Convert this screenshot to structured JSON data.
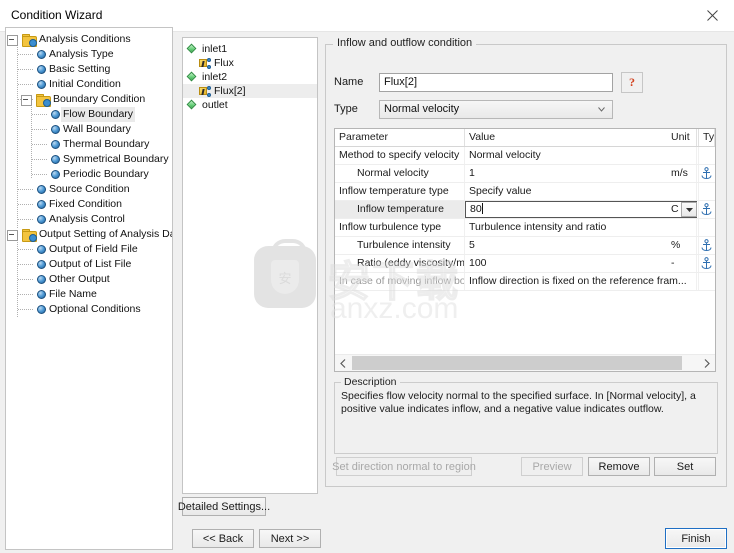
{
  "window": {
    "title": "Condition Wizard",
    "close_icon": "close-icon"
  },
  "tree": {
    "nodes": [
      {
        "label": "Analysis Conditions",
        "depth": 0,
        "icon": "folder",
        "expander": "minus"
      },
      {
        "label": "Analysis Type",
        "depth": 1,
        "icon": "sphere"
      },
      {
        "label": "Basic Setting",
        "depth": 1,
        "icon": "sphere"
      },
      {
        "label": "Initial Condition",
        "depth": 1,
        "icon": "sphere"
      },
      {
        "label": "Boundary Condition",
        "depth": 1,
        "icon": "folder",
        "expander": "minus"
      },
      {
        "label": "Flow Boundary",
        "depth": 2,
        "icon": "sphere",
        "highlight": true
      },
      {
        "label": "Wall Boundary",
        "depth": 2,
        "icon": "sphere"
      },
      {
        "label": "Thermal Boundary",
        "depth": 2,
        "icon": "sphere"
      },
      {
        "label": "Symmetrical Boundary",
        "depth": 2,
        "icon": "sphere"
      },
      {
        "label": "Periodic Boundary",
        "depth": 2,
        "icon": "sphere"
      },
      {
        "label": "Source Condition",
        "depth": 1,
        "icon": "sphere"
      },
      {
        "label": "Fixed Condition",
        "depth": 1,
        "icon": "sphere"
      },
      {
        "label": "Analysis Control",
        "depth": 1,
        "icon": "sphere"
      },
      {
        "label": "Output Setting of Analysis Data",
        "depth": 0,
        "icon": "folder",
        "expander": "minus"
      },
      {
        "label": "Output of Field File",
        "depth": 1,
        "icon": "sphere"
      },
      {
        "label": "Output of List File",
        "depth": 1,
        "icon": "sphere"
      },
      {
        "label": "Other Output",
        "depth": 1,
        "icon": "sphere"
      },
      {
        "label": "File Name",
        "depth": 0.5,
        "icon": "sphere"
      },
      {
        "label": "Optional Conditions",
        "depth": 0.5,
        "icon": "sphere"
      }
    ]
  },
  "region_list": {
    "items": [
      {
        "label": "inlet1",
        "icon": "region-diamond-icon",
        "indent": 0,
        "selected": false
      },
      {
        "label": "Flux",
        "icon": "flux-icon",
        "indent": 1,
        "selected": false
      },
      {
        "label": "inlet2",
        "icon": "region-diamond-icon",
        "indent": 0,
        "selected": false
      },
      {
        "label": "Flux[2]",
        "icon": "flux-icon",
        "indent": 1,
        "selected": true
      },
      {
        "label": "outlet",
        "icon": "region-diamond-icon",
        "indent": 0,
        "selected": false
      }
    ]
  },
  "panel": {
    "group_title": "Inflow and outflow condition",
    "name_label": "Name",
    "name_value": "Flux[2]",
    "help_glyph": "?",
    "type_label": "Type",
    "type_value": "Normal velocity"
  },
  "table": {
    "columns": [
      "Parameter",
      "Value",
      "Unit",
      "Typ"
    ],
    "rows": [
      {
        "parameter": "Method to specify velocity",
        "value": "Normal velocity",
        "unit": "",
        "type_icon": false,
        "indent": false
      },
      {
        "parameter": "Normal velocity",
        "value": "1",
        "unit": "m/s",
        "type_icon": true,
        "indent": true
      },
      {
        "parameter": "Inflow temperature type",
        "value": "Specify value",
        "unit": "",
        "type_icon": false,
        "indent": false
      },
      {
        "parameter": "Inflow temperature",
        "value": "80",
        "unit": "C",
        "type_icon": true,
        "indent": true,
        "editing": true,
        "unit_dropdown": true
      },
      {
        "parameter": "Inflow turbulence type",
        "value": "Turbulence intensity and ratio",
        "unit": "",
        "type_icon": false,
        "indent": false
      },
      {
        "parameter": "Turbulence intensity",
        "value": "5",
        "unit": "%",
        "type_icon": true,
        "indent": true
      },
      {
        "parameter": "Ratio (eddy viscosity/mol...",
        "value": "100",
        "unit": "-",
        "type_icon": true,
        "indent": true
      },
      {
        "parameter": "In case of moving inflow bou...",
        "value": "Inflow direction is fixed on the reference fram...",
        "unit": "",
        "type_icon": false,
        "indent": false
      }
    ],
    "scroll_left_icon": "chevron-left-icon",
    "scroll_right_icon": "chevron-right-icon"
  },
  "description": {
    "title": "Description",
    "text": "Specifies flow velocity normal to the specified surface. In [Normal velocity], a positive value indicates inflow, and a negative value indicates outflow."
  },
  "panel_buttons": {
    "set_direction": "Set direction normal to region",
    "preview": "Preview",
    "remove": "Remove",
    "set": "Set"
  },
  "footer": {
    "detailed_settings": "Detailed Settings...",
    "back": "<< Back",
    "next": "Next >>",
    "finish": "Finish"
  },
  "watermark": {
    "cn_text": "安下载",
    "domain_text": "anxz.com",
    "badge_glyph": "安"
  },
  "colors": {
    "accent": "#1f6fc4",
    "window_bg": "#f0f0f0",
    "field_bg": "#ffffff",
    "help_red": "#d2411e",
    "folder_yellow": "#f3c43f",
    "sphere_blue": "#3a8ed0",
    "region_green": "#65cf77"
  }
}
